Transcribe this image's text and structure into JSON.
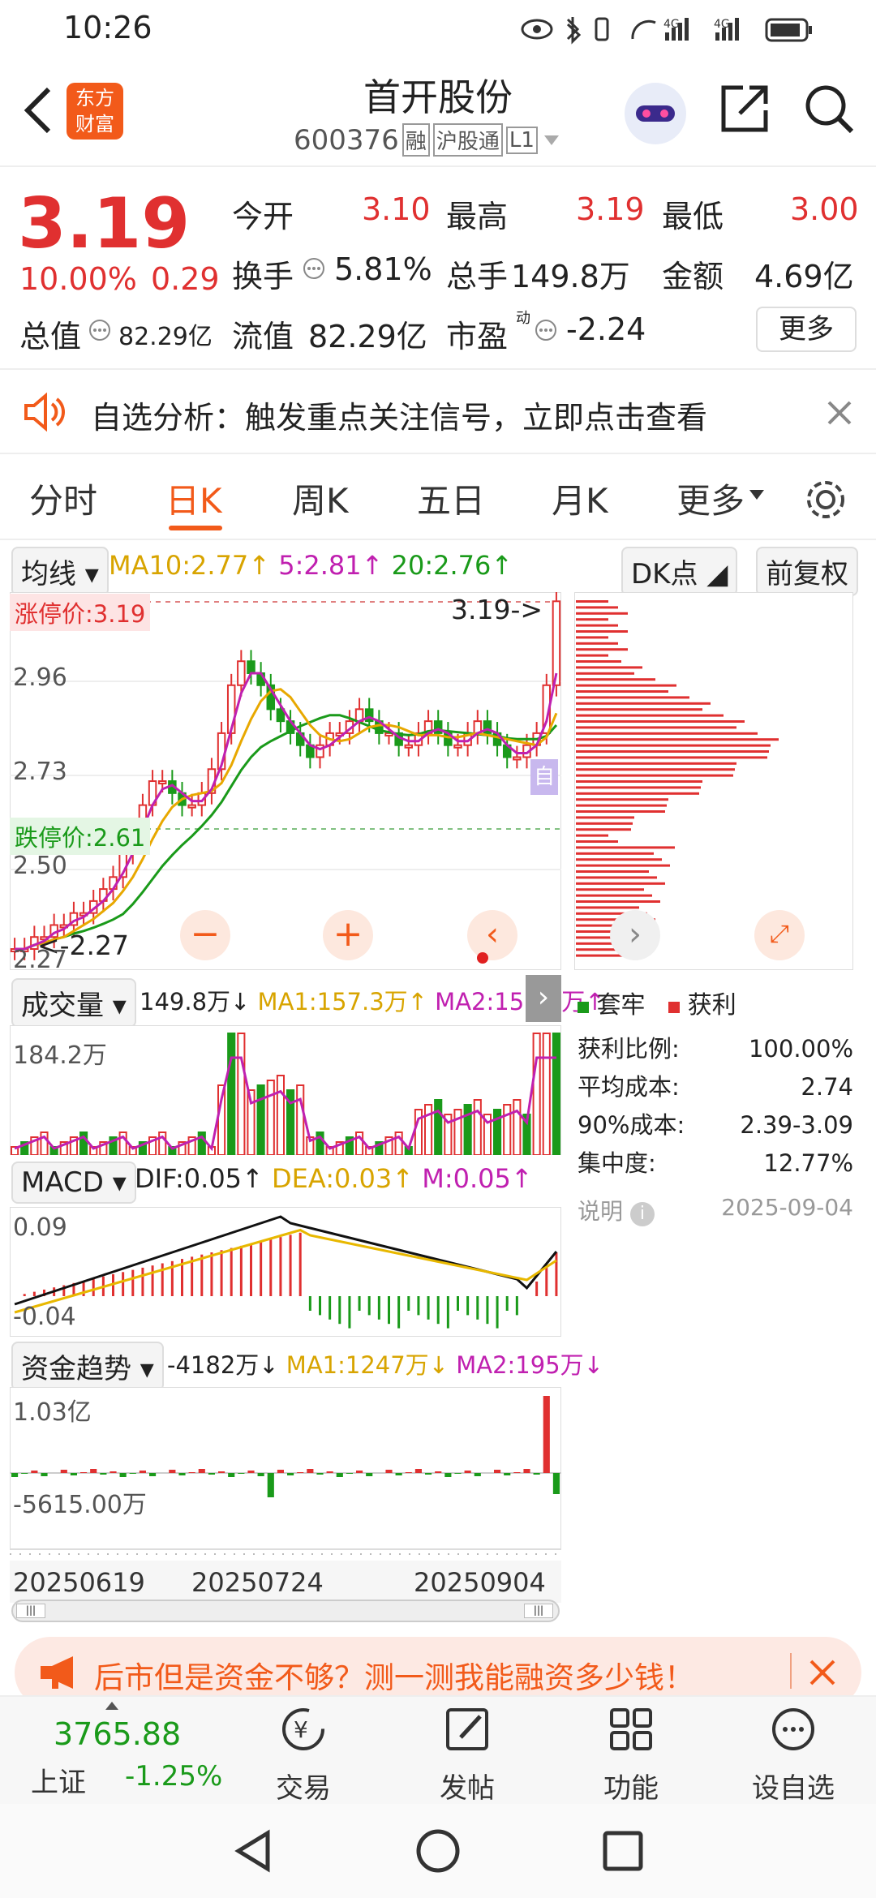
{
  "status_bar": {
    "time": "10:26",
    "net1": "4G",
    "net2": "4G"
  },
  "header": {
    "logo_line1": "东方",
    "logo_line2": "财富",
    "title": "首开股份",
    "code": "600376",
    "tag_rong": "融",
    "tag_hgt": "沪股通",
    "tag_level": "L1"
  },
  "quote": {
    "price": "3.19",
    "pct": "10.00%",
    "change": "0.29",
    "open_label": "今开",
    "open": "3.10",
    "high_label": "最高",
    "high": "3.19",
    "low_label": "最低",
    "low": "3.00",
    "turnover_label": "换手",
    "turnover": "5.81%",
    "volume_label": "总手",
    "volume": "149.8万",
    "amount_label": "金额",
    "amount": "4.69亿",
    "mktcap_label": "总值",
    "mktcap": "82.29亿",
    "float_label": "流值",
    "float": "82.29亿",
    "pe_label": "市盈",
    "pe_sup": "动",
    "pe": "-2.24",
    "more": "更多"
  },
  "banner": {
    "text": "自选分析：触发重点关注信号，立即点击查看"
  },
  "tabs": {
    "items": [
      "分时",
      "日K",
      "周K",
      "五日",
      "月K",
      "更多"
    ],
    "active": "日K"
  },
  "kline": {
    "ma_selector": "均线",
    "ma10": "MA10:2.77↑",
    "ma5": "5:2.81↑",
    "ma20": "20:2.76↑",
    "dk_button": "DK点",
    "fq_button": "前复权",
    "limit_up": "涨停价:3.19",
    "limit_down": "跌停价:2.61",
    "high_marker": "3.19->",
    "low_marker": "<-2.27",
    "y_labels": [
      "2.96",
      "2.73",
      "2.50",
      "2.27"
    ],
    "self_tag": "自"
  },
  "volume": {
    "selector": "成交量",
    "value": "149.8万↓",
    "ma1": "MA1:157.3万↑",
    "ma2": "MA2:157.3万↑",
    "top_label": "184.2万"
  },
  "macd": {
    "selector": "MACD",
    "dif": "DIF:0.05↑",
    "dea": "DEA:0.03↑",
    "m": "M:0.05↑",
    "top": "0.09",
    "bottom": "-0.04"
  },
  "fund": {
    "selector": "资金趋势",
    "value": "-4182万↓",
    "ma1": "MA1:1247万↓",
    "ma2": "MA2:195万↓",
    "top": "1.03亿",
    "bottom": "-5615.00万"
  },
  "dates": [
    "20250619",
    "20250724",
    "20250904"
  ],
  "chip": {
    "legend_trapped": "套牢",
    "legend_profit": "获利",
    "rows": [
      {
        "label": "获利比例:",
        "value": "100.00%"
      },
      {
        "label": "平均成本:",
        "value": "2.74"
      },
      {
        "label": "90%成本:",
        "value": "2.39-3.09"
      },
      {
        "label": "集中度:",
        "value": "12.77%"
      }
    ],
    "note_label": "说明",
    "note_date": "2025-09-04"
  },
  "ad": {
    "text": "后市但是资金不够？测一测我能融资多少钱！"
  },
  "bottom_nav": {
    "index_value": "3765.88",
    "index_name": "上证",
    "index_pct": "-1.25%",
    "items": [
      "交易",
      "发帖",
      "功能",
      "设自选"
    ]
  },
  "colors": {
    "up": "#e03030",
    "down": "#1a9a1a",
    "ma5": "#c020b0",
    "ma10": "#e8a800",
    "ma20": "#1a9a1a",
    "accent": "#f25a1a"
  }
}
